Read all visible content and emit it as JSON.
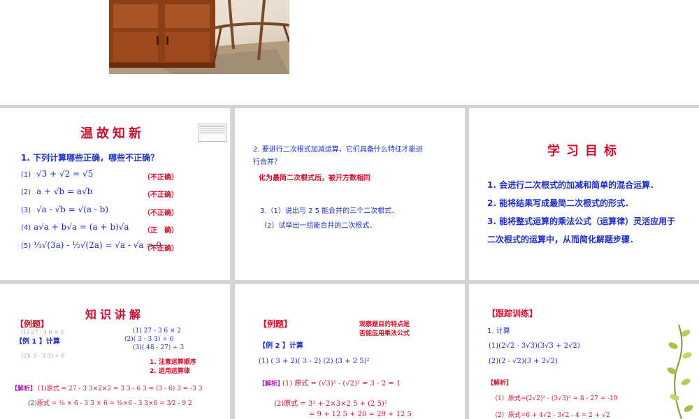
{
  "slide1": {
    "title": "温故知新",
    "question": "1. 下列计算哪些正确，哪些不正确？",
    "items": [
      {
        "num": "(1)",
        "expr": "√3 + √2 = √5",
        "verdict": "（不正确）"
      },
      {
        "num": "(2)",
        "expr": "a + √b = a√b",
        "verdict": "（不正确）"
      },
      {
        "num": "(3)",
        "expr": "√a - √b = √(a - b)",
        "verdict": "（不正确）"
      },
      {
        "num": "(4)",
        "expr": "a√a + b√a = (a + b)√a",
        "verdict": "（正　确）"
      },
      {
        "num": "(5)",
        "expr": "⅓√(3a) - ½√(2a) = √a - √a = 0",
        "verdict": "（不正确）"
      }
    ]
  },
  "slide2": {
    "q2": "2. 要进行二次根式加减运算，它们具备什么特征才能进",
    "q2_cont": "行合并？",
    "answer": "化为最简二次根式后，被开方数相同",
    "q3_1": "3.（1）说出与 2  5  能合并的三个二次根式．",
    "q3_2": "（2）试举出一组能合并的二次根式．"
  },
  "slide3": {
    "title": "学习目标",
    "goals": [
      "1. 会进行二次根式的加减和简单的混合运算．",
      "2. 能将结果写成最简二次根式的形式．",
      "3. 能将整式运算的乘法公式（运算律）灵活应用于"
    ],
    "goal3_cont": "二次根式的运算中，从而简化解题步骤．"
  },
  "slide4": {
    "title": "知识讲解",
    "tag": "【例题】",
    "example_label": "【例 1 】计算",
    "problem_1": "(1)  27 - 3   6 ×  2",
    "problem_2": "(2)(  3 - 3  3) ÷   6",
    "problem_3": "(3)(  48 -   27) ÷ 3",
    "note_1": "1. 注意运算顺序",
    "note_2": "2. 运用运算律",
    "analysis_label": "【解析】",
    "step_1": "(1)原式 = 27 - 3 3×2×2 = 3 3 - 6 3 = (3 - 6) 3 = -3 3",
    "step_2": "(2)原式 = ⅜ × 6 - 3 3 × 6 = ⅜×6 - 3 3×6 = 3⁄2 - 9 2"
  },
  "slide5": {
    "tag": "【例题】",
    "hint": "观察题目的特点是",
    "hint_2": "否能应用乘法公式",
    "example_label": "【例 2 】计算",
    "problems": "(1)  (  3 +   2)(  3 -   2)    (2)  (3 + 2  5)²",
    "analysis_label": "【解析】",
    "step_1": "(1) 原式 = (√3)² - (√2)² = 3 - 2 = 1",
    "step_2": "(2)原式 = 3² + 2×3×2  5 + (2  5)²",
    "step_3": "= 9 + 12  5 + 20 = 29 + 12  5"
  },
  "slide6": {
    "tag": "【跟踪训练】",
    "item": "1. 计算",
    "p1": "(1)(2√2 - 3√3)(3√3 + 2√2)",
    "p2": "(2)(2 - √2)(3 + 2√2)",
    "analysis_label": "【解析】",
    "a1": "（1）原式=(2√2)² - (3√3)² = 8 - 27 = -19",
    "a2": "（2）原式=6 + 4√2 - 3√2 - 4 = 2 + √2"
  },
  "colors": {
    "title_red": "#c8102e",
    "text_blue": "#1f2fc8",
    "answer_red": "#d4102a",
    "background": "#d4d4d4"
  }
}
